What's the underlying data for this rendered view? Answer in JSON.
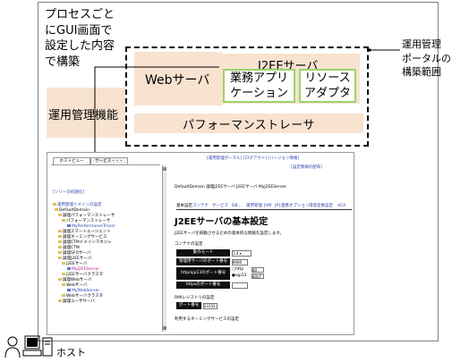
{
  "diagram": {
    "title_lines": [
      "プロセスごと",
      "にGUI画面で",
      "設定した内容",
      "で構築"
    ],
    "web_server": "Webサーバ",
    "j2ee_server": "J2EEサーバ",
    "business_app": [
      "業務アプリ",
      "ケーション"
    ],
    "resource_adapter": [
      "リソース",
      "アダプタ"
    ],
    "mgmt_function": "運用管理機能",
    "performance_tracer": "パフォーマンストレーサ",
    "portal_scope": [
      "運用管理",
      "ポータルの",
      "構築範囲"
    ],
    "host": "ホスト"
  },
  "screenshot": {
    "top_links": "[運用管理ポータル] [ログアウト] [バージョン情報]",
    "config_link": "[設定情報の配布]",
    "left_tabs": [
      "ホストビュー",
      "サービス・・・"
    ],
    "tree_init": "[ツリーの初期化]",
    "tree": [
      "運用管理ドメインの設定",
      "DefaultDomain",
      "論理パフォーマンストレーサ",
      "パフォーマンストレーサ",
      "MyPerformanceTracer",
      "論理スマートエージェント",
      "論理ネーミングサービス",
      "論理CTMドメインマネジャ",
      "論理CTM",
      "論理SFOサーバ",
      "論理J2EEサーバ",
      "J2EEサーバ",
      "MyJ2EEServer",
      "J2EEサーバクラスタ",
      "論理Webサーバ",
      "Webサーバ",
      "MyWebServer",
      "Webサーバクラスタ",
      "論理ユーザサーバ"
    ],
    "breadcrumb": "DefaultDomain  論理J2EEサーバ  J2EEサーバ  MyJ2EEServer",
    "right_tabs": [
      "基本設定",
      "コンテナ",
      "サービス",
      "DB...",
      "運用管理",
      "JVM",
      "JP1連携",
      "オプション",
      "環境変数設定",
      "ACA"
    ],
    "page_title": "J2EEサーバの基本設定",
    "description": "J2EEサーバを稼動させるための基本的な情報を設定します。",
    "container_heading": "コンテナの設定",
    "rows": [
      {
        "label": "動作モード",
        "value": "1.4"
      },
      {
        "label": "管理用サーバのポート番号",
        "value": "8080"
      },
      {
        "label": "http/ajp13のポート番号",
        "value": "80"
      },
      {
        "label": "httpsのポート番号",
        "value": ""
      }
    ],
    "radio_http": "http",
    "radio_ajp13": "ajp13",
    "ajp_value": "8007",
    "rmi_heading": "RMIレジストリの設定",
    "port_label": "ポート番号",
    "port_value": "23152",
    "naming_note": "利用するネーミングサービスの設定"
  }
}
